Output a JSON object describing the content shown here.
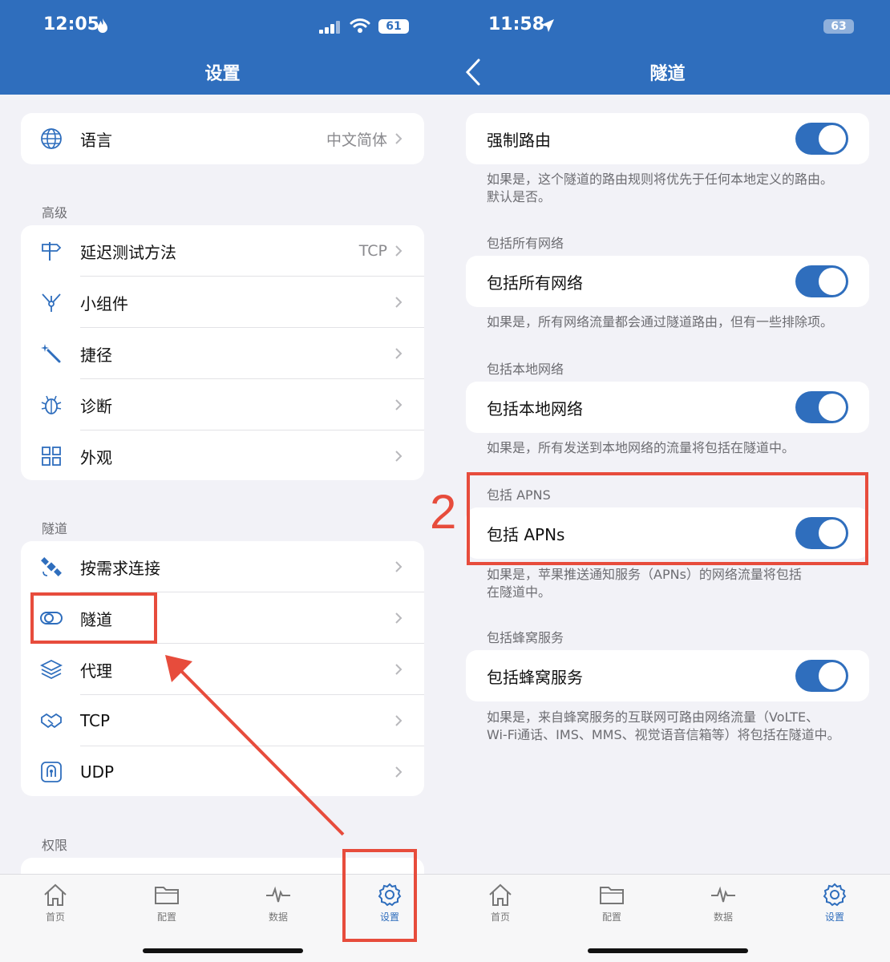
{
  "left": {
    "status": {
      "time": "12:05",
      "battery": "61"
    },
    "title": "设置",
    "language": {
      "label": "语言",
      "value": "中文简体"
    },
    "sections": {
      "advanced": "高级",
      "tunnel": "隧道",
      "permissions": "权限"
    },
    "advanced_items": [
      {
        "label": "延迟测试方法",
        "value": "TCP"
      },
      {
        "label": "小组件"
      },
      {
        "label": "捷径"
      },
      {
        "label": "诊断"
      },
      {
        "label": "外观"
      }
    ],
    "tunnel_items": [
      {
        "label": "按需求连接"
      },
      {
        "label": "隧道"
      },
      {
        "label": "代理"
      },
      {
        "label": "TCP"
      },
      {
        "label": "UDP"
      }
    ]
  },
  "right": {
    "status": {
      "time": "11:58",
      "battery": "63"
    },
    "title": "隧道",
    "force_route": {
      "label": "强制路由",
      "desc1": "如果是，这个隧道的路由规则将优先于任何本地定义的路由。",
      "desc2": "默认是否。",
      "on": true
    },
    "all_networks": {
      "header": "包括所有网络",
      "label": "包括所有网络",
      "desc": "如果是，所有网络流量都会通过隧道路由，但有一些排除项。",
      "on": true
    },
    "local_networks": {
      "header": "包括本地网络",
      "label": "包括本地网络",
      "desc": "如果是，所有发送到本地网络的流量将包括在隧道中。",
      "on": true
    },
    "apns": {
      "header": "包括 APNS",
      "label": "包括 APNs",
      "desc1": "如果是，苹果推送通知服务（APNs）的网络流量将包括",
      "desc2": "在隧道中。",
      "on": true
    },
    "cellular": {
      "header": "包括蜂窝服务",
      "label": "包括蜂窝服务",
      "desc1": "如果是，来自蜂窝服务的互联网可路由网络流量（VoLTE、",
      "desc2": "Wi-Fi通话、IMS、MMS、视觉语音信箱等）将包括在隧道中。",
      "on": true
    }
  },
  "tabs": [
    {
      "label": "首页",
      "icon": "home-icon"
    },
    {
      "label": "配置",
      "icon": "folder-icon"
    },
    {
      "label": "数据",
      "icon": "activity-icon"
    },
    {
      "label": "设置",
      "icon": "gear-icon",
      "active": true
    }
  ],
  "annotation": {
    "step_number": "2"
  },
  "colors": {
    "accent": "#2f6ebd",
    "annotation": "#e74c3c",
    "background": "#f2f2f7"
  }
}
